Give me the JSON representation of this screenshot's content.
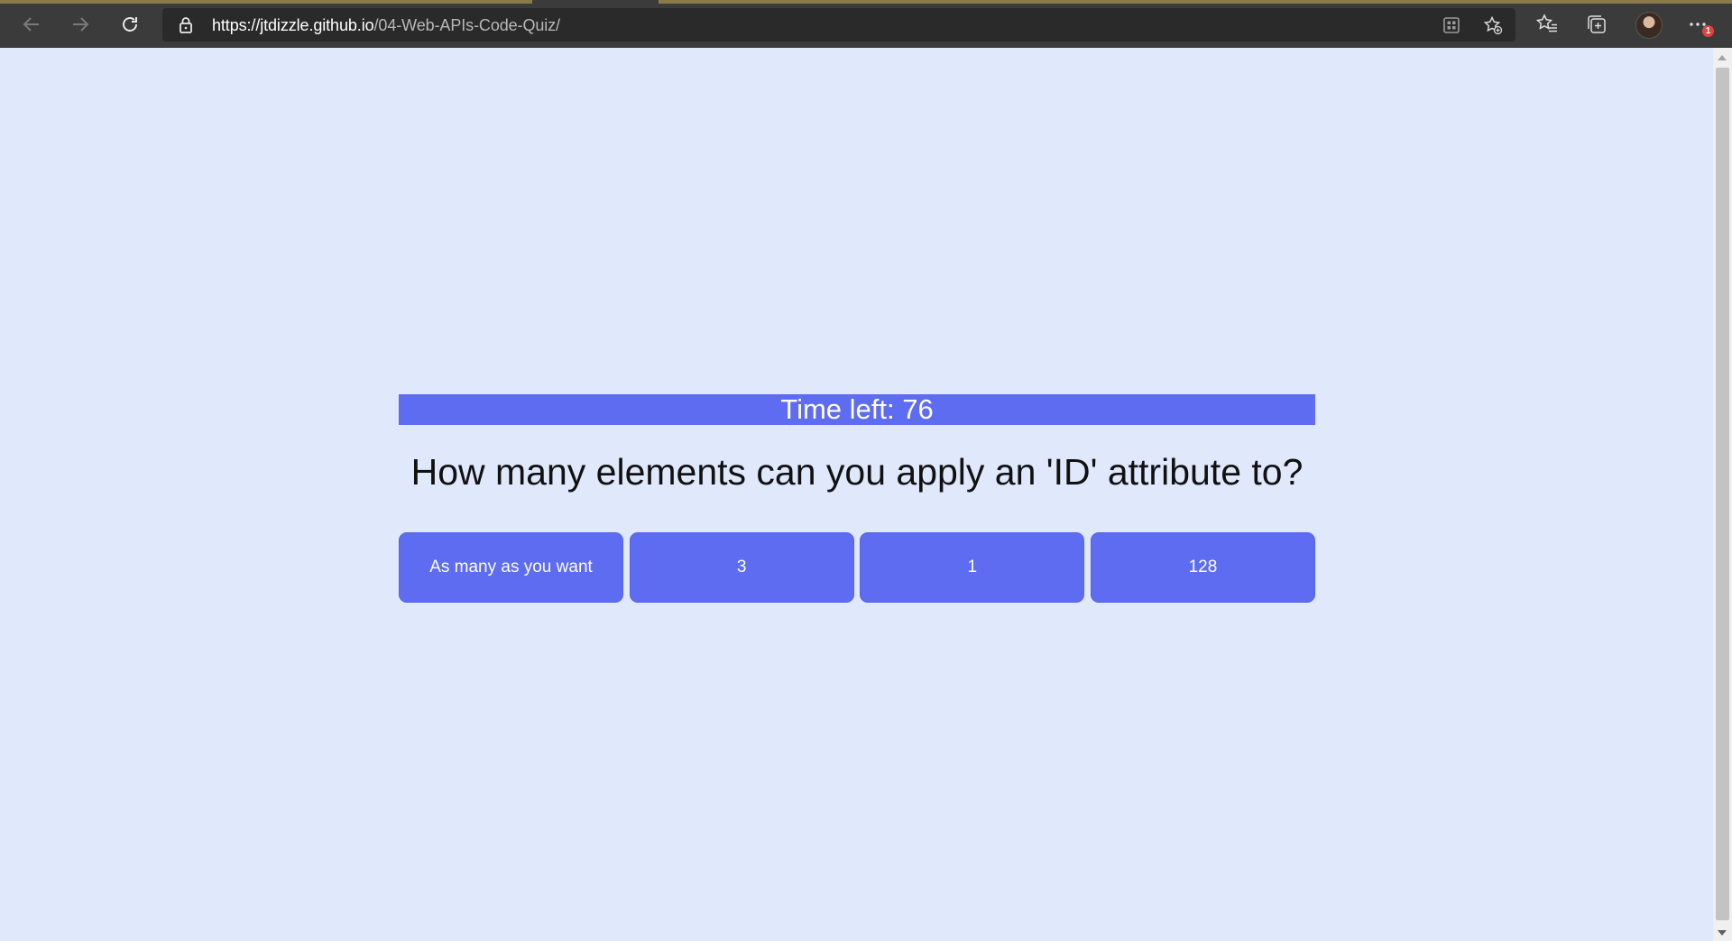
{
  "browser": {
    "url_host": "https://jtdizzle.github.io",
    "url_path": "/04-Web-APIs-Code-Quiz/",
    "notification_count": "1",
    "icons": {
      "back": "arrow-left-icon",
      "forward": "arrow-right-icon",
      "refresh": "refresh-icon",
      "lock": "lock-icon",
      "reader": "app-grid-icon",
      "favorite_add": "star-add-icon",
      "favorites": "favorites-list-icon",
      "collections": "collections-icon",
      "profile": "avatar",
      "menu": "more-icon"
    }
  },
  "quiz": {
    "timer_label": "Time left: 76",
    "question": "How many elements can you apply an 'ID' attribute to?",
    "answers": [
      {
        "label": "As many as you want"
      },
      {
        "label": "3"
      },
      {
        "label": "1"
      },
      {
        "label": "128"
      }
    ]
  },
  "colors": {
    "page_background": "#e0e8fc",
    "accent": "#5d6cf0",
    "browser_chrome": "#3b3b3b"
  }
}
